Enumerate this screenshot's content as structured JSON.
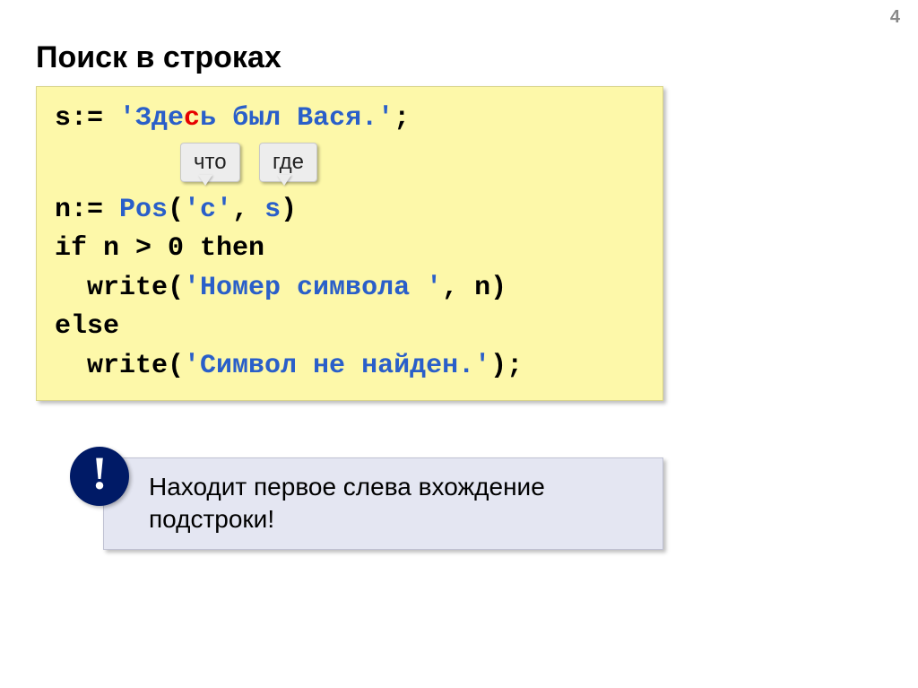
{
  "page_number": "4",
  "heading": "Поиск в строках",
  "code": {
    "line1_pre": "s:= ",
    "line1_str_open": "'",
    "line1_str_part1": "Зде",
    "line1_str_red": "с",
    "line1_str_part2": "ь был Вася.",
    "line1_str_close": "'",
    "line1_post": ";",
    "callout1": "что",
    "callout2": "где",
    "line2_pre": "n:= ",
    "line2_fn": "Pos",
    "line2_open": "(",
    "line2_arg1": "'с'",
    "line2_mid": ", ",
    "line2_arg2": "s",
    "line2_close": ")",
    "line3": "if n > 0 then",
    "line4_pre": "  write(",
    "line4_str": "'Номер символа '",
    "line4_post": ", n)",
    "line5": "else",
    "line6_pre": "  write(",
    "line6_str": "'Символ не найден.'",
    "line6_post": ");"
  },
  "note": {
    "bang": "!",
    "text1": " Находит первое слева вхождение",
    "text2": "подстроки!"
  }
}
